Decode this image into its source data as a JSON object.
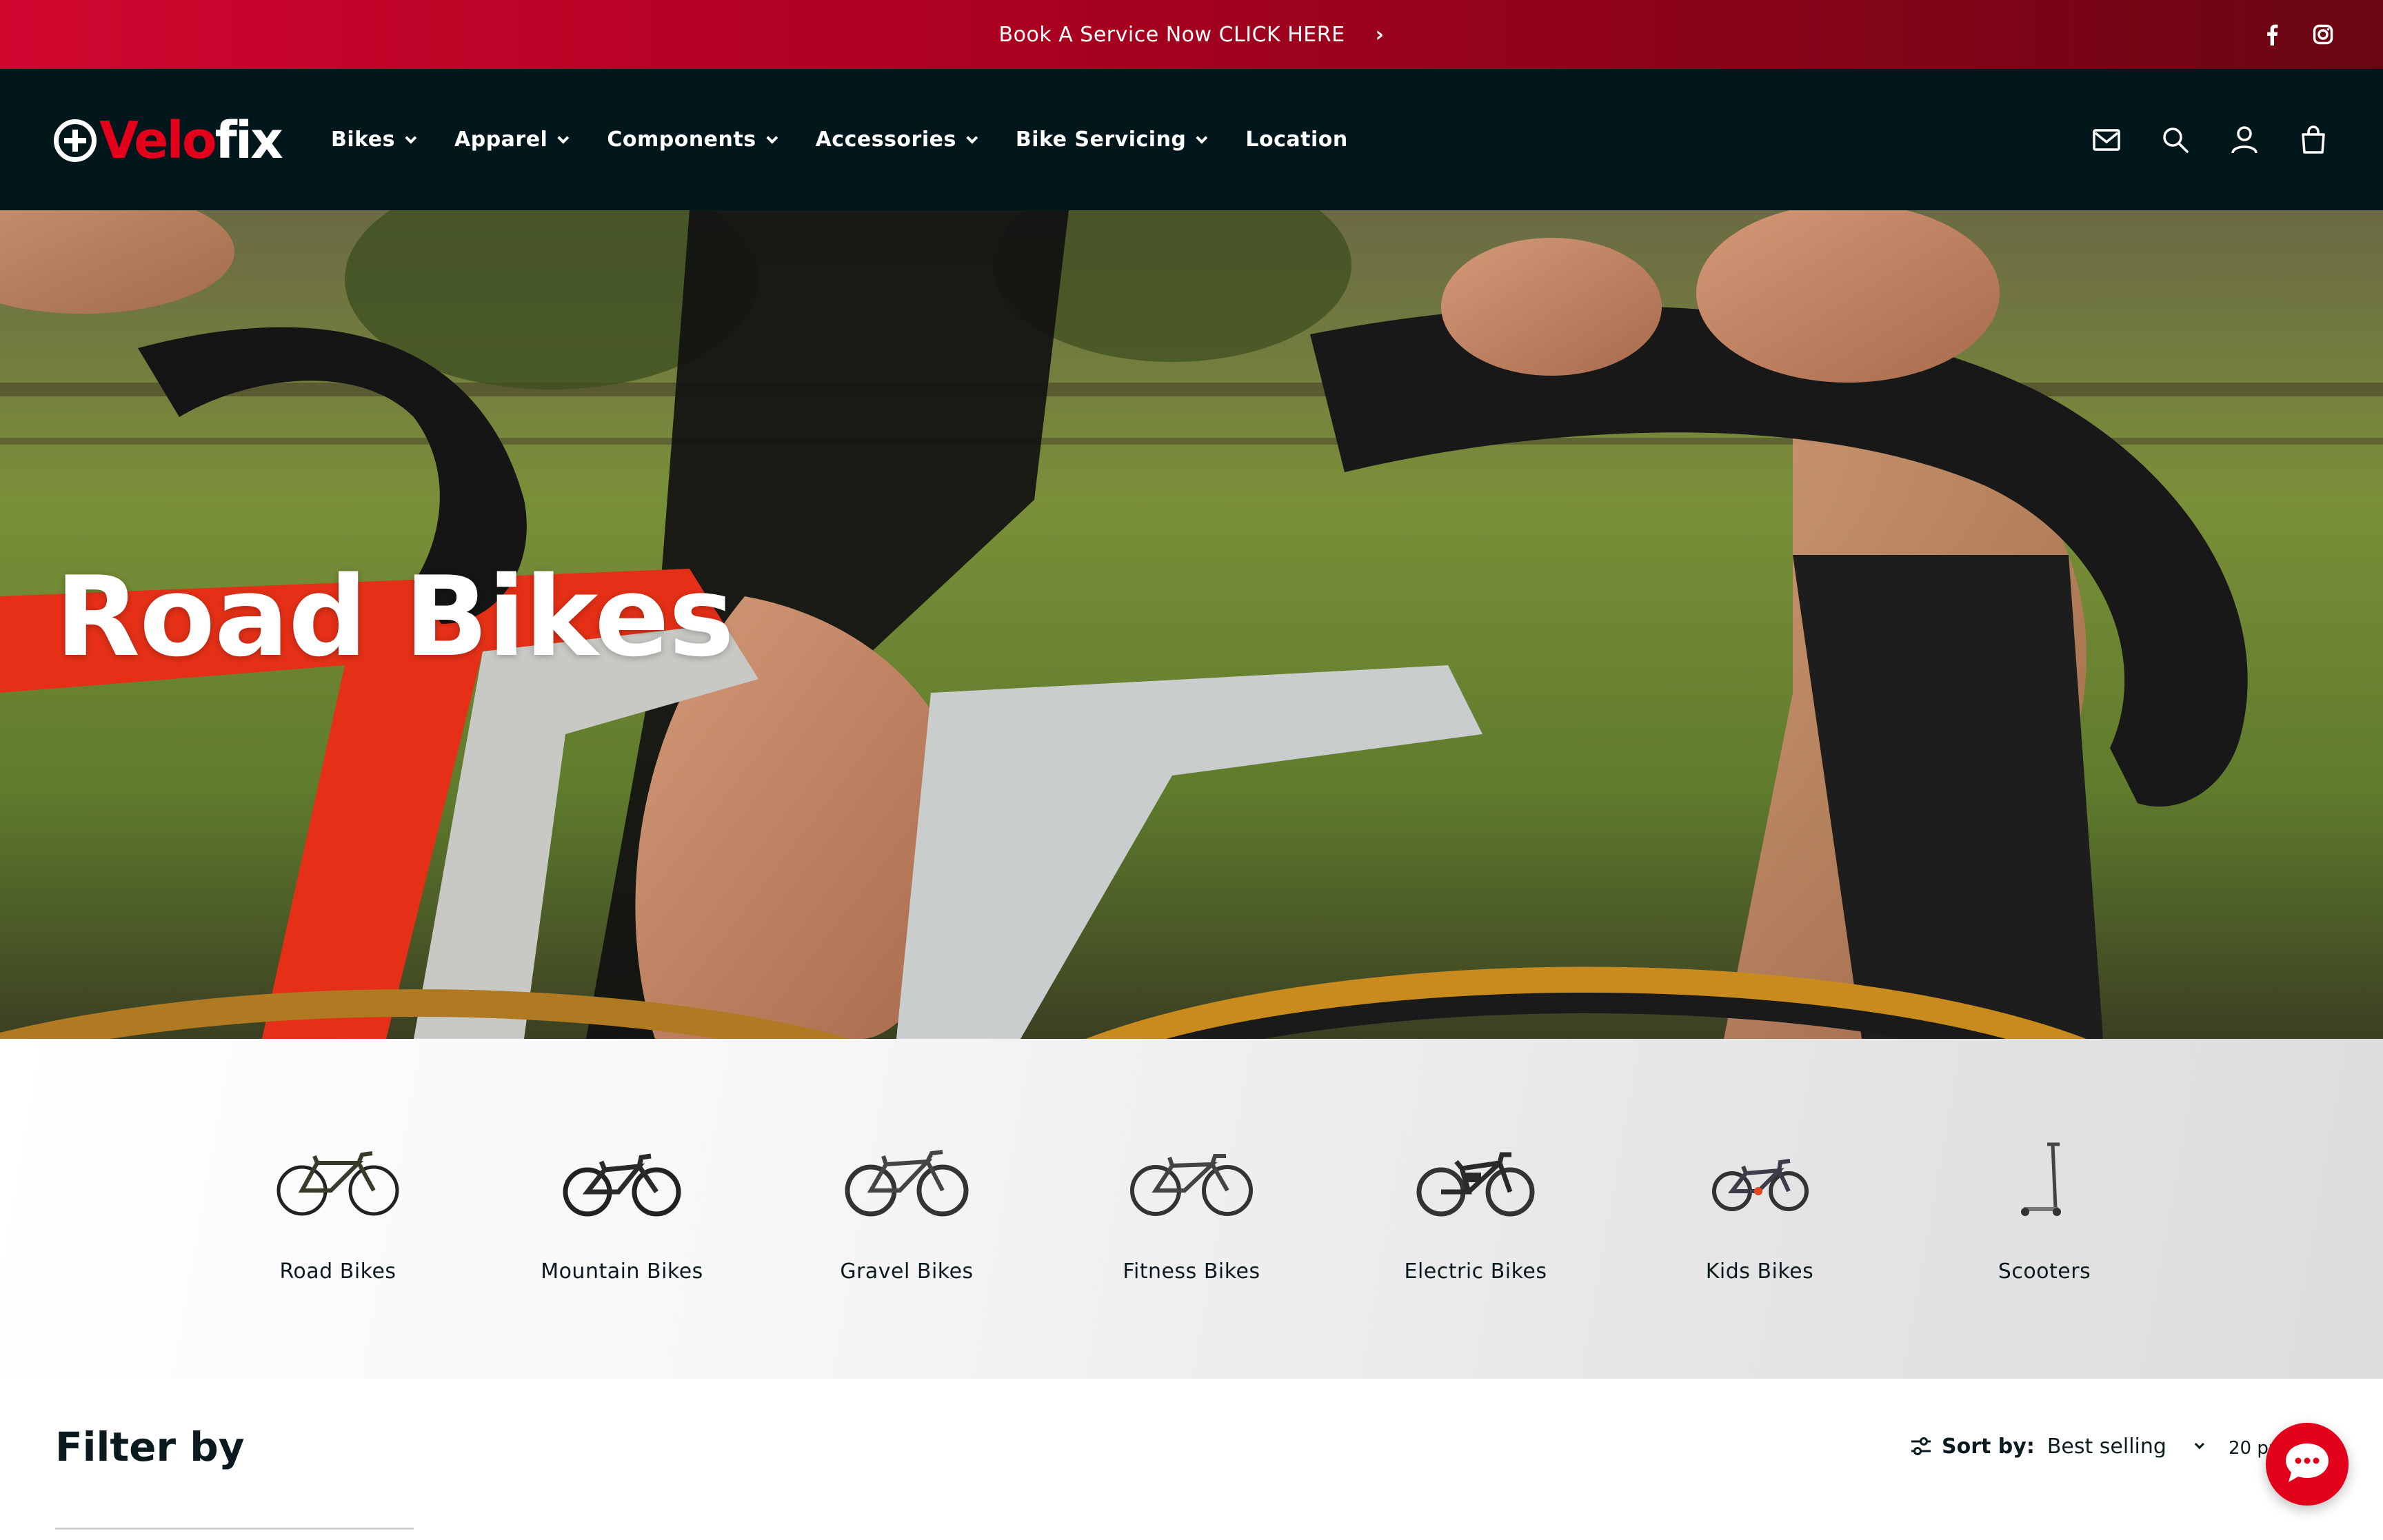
{
  "announcement": {
    "text": "Book A Service Now CLICK HERE",
    "arrow": "›",
    "social": [
      "facebook-icon",
      "instagram-icon"
    ],
    "colors": [
      "#d0062f",
      "#6a0612"
    ]
  },
  "header": {
    "logo": {
      "part1": "Velo",
      "part2": "fix"
    },
    "nav": [
      {
        "label": "Bikes",
        "has_dropdown": true
      },
      {
        "label": "Apparel",
        "has_dropdown": true
      },
      {
        "label": "Components",
        "has_dropdown": true
      },
      {
        "label": "Accessories",
        "has_dropdown": true
      },
      {
        "label": "Bike Servicing",
        "has_dropdown": true
      },
      {
        "label": "Location",
        "has_dropdown": false
      }
    ],
    "icons": [
      "mail-icon",
      "search-icon",
      "account-icon",
      "cart-icon"
    ],
    "background": "#02171c"
  },
  "hero": {
    "title": "Road Bikes"
  },
  "categories": [
    {
      "label": "Road Bikes",
      "icon": "road-bike-icon"
    },
    {
      "label": "Mountain Bikes",
      "icon": "mountain-bike-icon"
    },
    {
      "label": "Gravel Bikes",
      "icon": "gravel-bike-icon"
    },
    {
      "label": "Fitness Bikes",
      "icon": "fitness-bike-icon"
    },
    {
      "label": "Electric Bikes",
      "icon": "electric-bike-icon"
    },
    {
      "label": "Kids Bikes",
      "icon": "kids-bike-icon"
    },
    {
      "label": "Scooters",
      "icon": "scooter-icon"
    }
  ],
  "filter": {
    "title": "Filter by"
  },
  "sort": {
    "label": "Sort by:",
    "value": "Best selling",
    "per_page": "20 pr"
  },
  "chat": {
    "icon": "chat-icon",
    "color": "#e3001b"
  }
}
